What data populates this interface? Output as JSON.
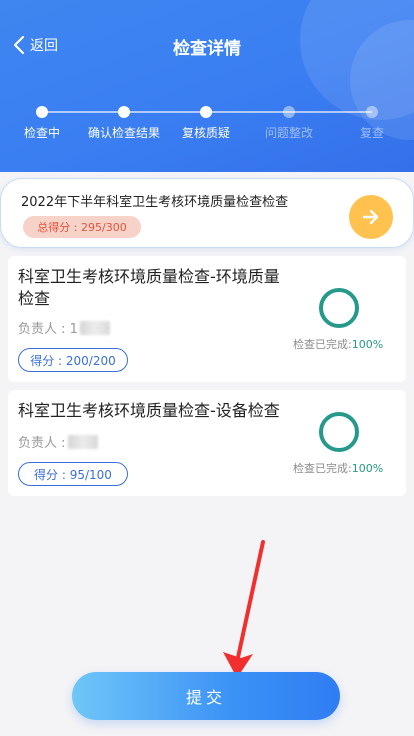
{
  "header": {
    "back_label": "返回",
    "title": "检查详情"
  },
  "steps": [
    {
      "label": "检查中",
      "active": true
    },
    {
      "label": "确认检查结果",
      "active": true
    },
    {
      "label": "复核质疑",
      "active": true
    },
    {
      "label": "问题整改",
      "active": false
    },
    {
      "label": "复查",
      "active": false
    }
  ],
  "summary": {
    "title": "2022年下半年科室卫生考核环境质量检查检查",
    "total_score_label": "总得分 : 295/300"
  },
  "items": [
    {
      "title": "科室卫生考核环境质量检查-环境质量检查",
      "owner_label": "负责人 : 1",
      "score_label": "得分 : 200/200",
      "progress_label": "检查已完成:",
      "progress_value": "100%"
    },
    {
      "title": "科室卫生考核环境质量检查-设备检查",
      "owner_label": "负责人 : ",
      "score_label": "得分 : 95/100",
      "progress_label": "检查已完成:",
      "progress_value": "100%"
    }
  ],
  "submit_label": "提交",
  "colors": {
    "primary": "#3a7ef2",
    "accent": "#ffc24f",
    "success": "#25998a",
    "danger": "#e1553b",
    "arrow": "#f22f2f"
  }
}
